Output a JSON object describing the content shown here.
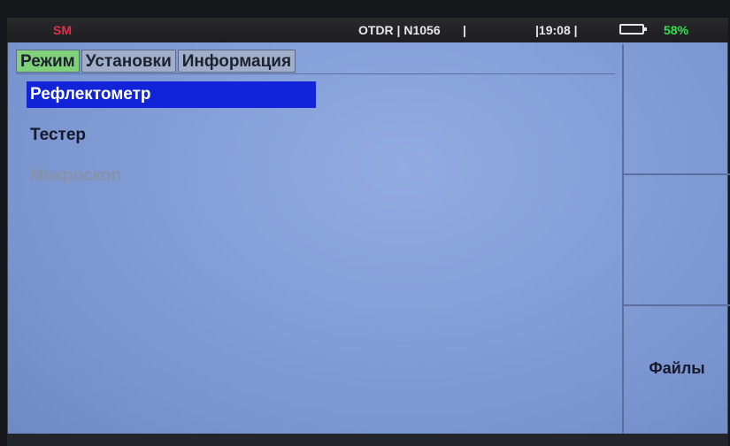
{
  "status_bar": {
    "fiber_mode": "SM",
    "device_info": "OTDR | N1056",
    "separator": "|",
    "time": "|19:08 |",
    "battery_percent": "58%"
  },
  "tabs": [
    {
      "label": "Режим",
      "active": true
    },
    {
      "label": "Установки",
      "active": false
    },
    {
      "label": "Информация",
      "active": false
    }
  ],
  "menu": {
    "items": [
      {
        "label": "Рефлектометр",
        "state": "selected"
      },
      {
        "label": "Тестер",
        "state": "normal"
      },
      {
        "label": "Микроскоп",
        "state": "disabled"
      }
    ]
  },
  "softkeys": {
    "key1_label": "",
    "key2_label": "",
    "key3_label": "Файлы"
  },
  "colors": {
    "screen_bg": "#86a0d9",
    "active_tab": "#7fd17a",
    "selection": "#1124d8",
    "fiber_mode": "#e0304a",
    "battery": "#33e14c"
  },
  "icons": {
    "battery": "battery-icon"
  }
}
